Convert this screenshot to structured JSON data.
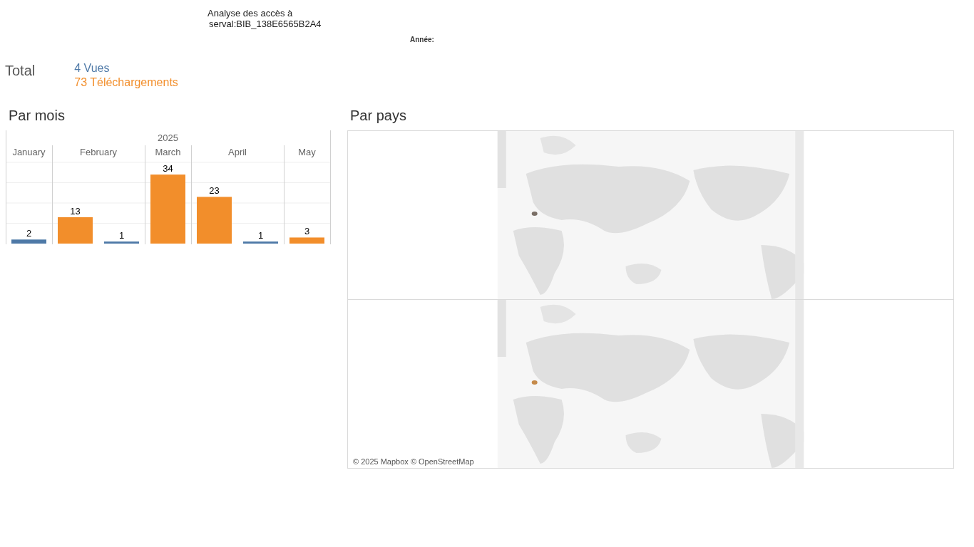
{
  "title": {
    "line_1": "Analyse des accès à",
    "line_2": "serval:BIB_138E6565B2A4"
  },
  "filter": {
    "label": "Année:"
  },
  "total": {
    "label": "Total",
    "views": "4 Vues",
    "downloads": "73 Téléchargements"
  },
  "par_mois": {
    "heading": "Par mois",
    "chart_data": {
      "type": "bar",
      "title": "2025",
      "categories": [
        "January",
        "February",
        "March",
        "April",
        "May"
      ],
      "series": [
        {
          "color": "#f28e2b",
          "values": [
            null,
            13,
            34,
            23,
            3
          ]
        },
        {
          "color": "#4e79a7",
          "values": [
            2,
            1,
            null,
            1,
            null
          ]
        }
      ],
      "ylim": [
        0,
        40
      ],
      "data_labels": true
    }
  },
  "par_pays": {
    "heading": "Par pays",
    "attribution": "© 2025 Mapbox © OpenStreetMap"
  }
}
